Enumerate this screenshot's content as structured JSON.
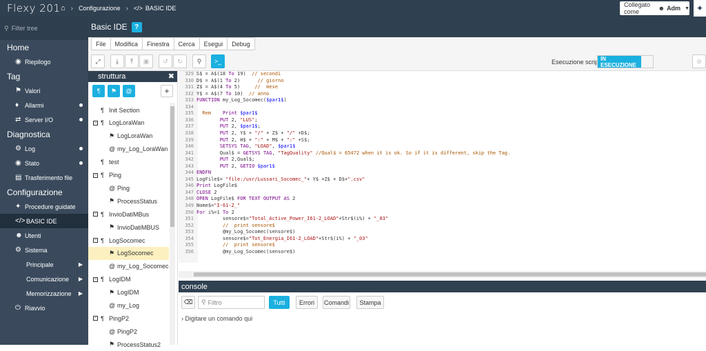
{
  "topbar": {
    "logo": "Flexy 201",
    "home_icon": "home-icon",
    "breadcrumb1": "Configurazione",
    "breadcrumb2": "BASIC IDE",
    "user_prefix": "Collegato come",
    "user_name": "Adm"
  },
  "sidebar": {
    "filter_placeholder": "Filter tree",
    "sections": [
      {
        "title": "Home",
        "items": [
          {
            "label": "Riepilogo",
            "icon": "speedometer-icon"
          }
        ]
      },
      {
        "title": "Tag",
        "items": [
          {
            "label": "Valori",
            "icon": "tag-icon"
          },
          {
            "label": "Allarmi",
            "icon": "bell-icon"
          },
          {
            "label": "Server I/O",
            "icon": "arrows-icon"
          }
        ]
      },
      {
        "title": "Diagnostica",
        "items": [
          {
            "label": "Log",
            "icon": "wrench-icon"
          },
          {
            "label": "Stato",
            "icon": "gauge-icon"
          },
          {
            "label": "Trasferimento file",
            "icon": "file-icon"
          }
        ]
      },
      {
        "title": "Configurazione",
        "items": [
          {
            "label": "Procedure guidate",
            "icon": "magic-icon"
          },
          {
            "label": "BASIC IDE",
            "icon": "code-icon"
          },
          {
            "label": "Utenti",
            "icon": "users-icon"
          },
          {
            "label": "Sistema",
            "icon": "gears-icon"
          },
          {
            "label": "Principale"
          },
          {
            "label": "Comunicazione"
          },
          {
            "label": "Memorizzazione"
          },
          {
            "label": "Riavvio",
            "icon": "power-icon"
          }
        ]
      }
    ]
  },
  "main": {
    "title": "Basic IDE",
    "menus": [
      "File",
      "Modifica",
      "Finestra",
      "Cerca",
      "Esegui",
      "Debug"
    ],
    "exec_label": "Esecuzione script",
    "exec_status": "IN ESECUZIONE"
  },
  "tree": {
    "title": "struttura",
    "nodes": [
      "Init Section",
      "LogLoraWan",
      "LogLoraWan",
      "my_Log_LoraWan",
      "test",
      "Ping",
      "Ping",
      "ProcessStatus",
      "InvioDatiMBus",
      "InvioDatiMBUS",
      "LogSocomec",
      "LogSocomec",
      "my_Log_Socomec",
      "LogIDM",
      "LogIDM",
      "my_Log",
      "PingP2",
      "PingP2",
      "ProcessStatus2"
    ]
  },
  "code": {
    "lines": [
      {
        "n": "329",
        "t": "S$ = A$(18 To 19)  // secondi"
      },
      {
        "n": "330",
        "t": "D$ = A$(1 To 2)      // giorno"
      },
      {
        "n": "331",
        "t": "Z$ = A$(4 To 5)     //  mese"
      },
      {
        "n": "332",
        "t": "Y$ = A$(7 To 10)  // anno"
      },
      {
        "n": "333",
        "t": "FUNCTION my_Log_Socomec($par1$)"
      },
      {
        "n": "334",
        "t": ""
      },
      {
        "n": "335",
        "t": "  Rem    Print $par1$"
      },
      {
        "n": "336",
        "t": "        PUT 2, \"LUS\";"
      },
      {
        "n": "337",
        "t": "        PUT 2, $par1$;"
      },
      {
        "n": "338",
        "t": "        PUT 2, Y$ + \"/\" + Z$ + \"/\" +D$;"
      },
      {
        "n": "339",
        "t": "        PUT 2, H$ + \":\" + M$ + \":\" +S$;"
      },
      {
        "n": "340",
        "t": "        SETSYS TAG, \"LOAD\", $par1$"
      },
      {
        "n": "341",
        "t": "        Qual$ = GETSYS TAG, \"TagQuality\" //Qual$ = 65472 when it is ok. So if it is different, skip the Tag."
      },
      {
        "n": "342",
        "t": "        PUT 2,Qual$;"
      },
      {
        "n": "343",
        "t": "        PUT 2, GETIO $par1$"
      },
      {
        "n": "344",
        "t": "ENDFN"
      },
      {
        "n": "345",
        "t": "LogFile$= \"file:/usr/Lussari_Socomec_\"+ Y$ +Z$ + D$+\".csv\""
      },
      {
        "n": "346",
        "t": "Print LogFile$"
      },
      {
        "n": "347",
        "t": "CLOSE 2"
      },
      {
        "n": "348",
        "t": "OPEN LogFile$ FOR TEXT OUTPUT AS 2"
      },
      {
        "n": "349",
        "t": "Nome$=\"I-61-2_\""
      },
      {
        "n": "350",
        "t": "For i%=1 To 2"
      },
      {
        "n": "351",
        "t": "         sensore$=\"Total_Active_Power_I61-2_LOAD\"+Str$(i%) + \"_03\""
      },
      {
        "n": "352",
        "t": "         //  print sensore$"
      },
      {
        "n": "353",
        "t": "         @my_Log_Socomec(sensore$)"
      },
      {
        "n": "354",
        "t": "         sensore$=\"Tot_Energia_I61-2_LOAD\"+Str$(i%) + \"_03\""
      },
      {
        "n": "355",
        "t": "         //  print sensore$"
      },
      {
        "n": "356",
        "t": "         @my_Log_Socomec(sensore$)"
      }
    ]
  },
  "console": {
    "title": "console",
    "filter_placeholder": "Filtro",
    "btn_all": "Tutti",
    "btn_errors": "Errori",
    "btn_commands": "Comandi",
    "btn_print": "Stampa",
    "prompt": "Digitare un comando qui"
  }
}
